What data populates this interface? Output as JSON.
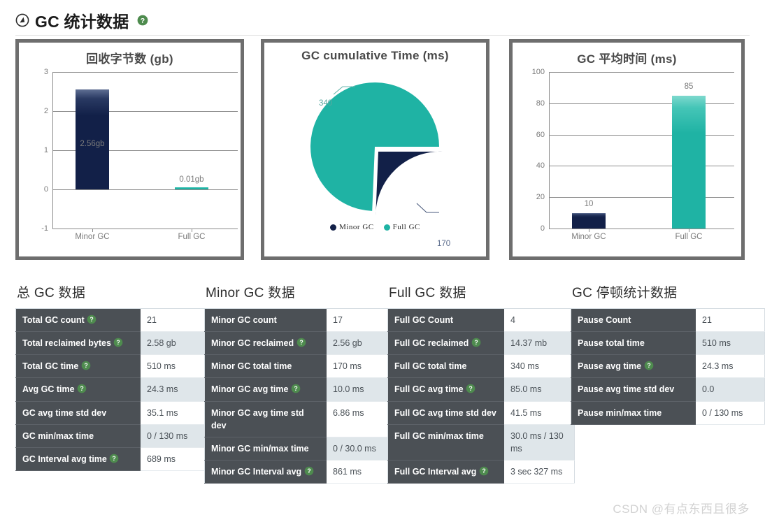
{
  "header": {
    "title": "GC 统计数据",
    "logo_icon": "circle-arrow-icon",
    "help_icon": "help-circle-icon"
  },
  "colors": {
    "navy": "#122048",
    "teal": "#1fb3a4",
    "table_label_bg": "#4b5055",
    "table_alt_bg": "#dfe6ea",
    "card_border": "#6e6e6e",
    "help_green": "#4e8b4e"
  },
  "chart_data": [
    {
      "type": "bar",
      "title": "回收字节数 (gb)",
      "categories": [
        "Minor GC",
        "Full GC"
      ],
      "values": [
        2.56,
        0.01
      ],
      "data_labels": [
        "2.56gb",
        "0.01gb"
      ],
      "series_colors": [
        "#122048",
        "#1fb3a4"
      ],
      "xlabel": "",
      "ylabel": "",
      "ylim": [
        -1,
        3
      ],
      "yticks": [
        "3",
        "2",
        "1",
        "0",
        "-1"
      ],
      "grid": true,
      "legend": "none"
    },
    {
      "type": "pie",
      "title": "GC cumulative Time (ms)",
      "categories": [
        "Minor GC",
        "Full GC"
      ],
      "values": [
        170,
        340
      ],
      "data_labels": [
        "170",
        "340"
      ],
      "series_colors": [
        "#122048",
        "#1fb3a4"
      ],
      "legend": "bottom",
      "legend_entries": [
        "Minor GC",
        "Full GC"
      ]
    },
    {
      "type": "bar",
      "title": "GC 平均时间 (ms)",
      "categories": [
        "Minor GC",
        "Full GC"
      ],
      "values": [
        10,
        85
      ],
      "data_labels": [
        "10",
        "85"
      ],
      "series_colors": [
        "#122048",
        "#1fb3a4"
      ],
      "xlabel": "",
      "ylabel": "",
      "ylim": [
        0,
        100
      ],
      "yticks": [
        "100",
        "80",
        "60",
        "40",
        "20",
        "0"
      ],
      "grid": true,
      "legend": "none"
    }
  ],
  "tables": [
    {
      "heading": "总 GC 数据",
      "rows": [
        {
          "label": "Total GC count",
          "help": true,
          "value": "21"
        },
        {
          "label": "Total reclaimed bytes",
          "help": true,
          "value": "2.58 gb"
        },
        {
          "label": "Total GC time",
          "help": true,
          "value": "510 ms"
        },
        {
          "label": "Avg GC time",
          "help": true,
          "value": "24.3 ms"
        },
        {
          "label": "GC avg time std dev",
          "help": false,
          "value": "35.1 ms"
        },
        {
          "label": "GC min/max time",
          "help": false,
          "value": "0 / 130 ms"
        },
        {
          "label": "GC Interval avg time",
          "help": true,
          "value": "689 ms"
        }
      ]
    },
    {
      "heading": "Minor GC 数据",
      "rows": [
        {
          "label": "Minor GC count",
          "help": false,
          "value": "17"
        },
        {
          "label": "Minor GC reclaimed",
          "help": true,
          "value": "2.56 gb"
        },
        {
          "label": "Minor GC total time",
          "help": false,
          "value": "170 ms"
        },
        {
          "label": "Minor GC avg time",
          "help": true,
          "value": "10.0 ms"
        },
        {
          "label": "Minor GC avg time std dev",
          "help": false,
          "value": "6.86 ms"
        },
        {
          "label": "Minor GC min/max time",
          "help": false,
          "value": "0 / 30.0 ms"
        },
        {
          "label": "Minor GC Interval avg",
          "help": true,
          "value": "861 ms"
        }
      ]
    },
    {
      "heading": "Full GC 数据",
      "rows": [
        {
          "label": "Full GC Count",
          "help": false,
          "value": "4"
        },
        {
          "label": "Full GC reclaimed",
          "help": true,
          "value": "14.37 mb"
        },
        {
          "label": "Full GC total time",
          "help": false,
          "value": "340 ms"
        },
        {
          "label": "Full GC avg time",
          "help": true,
          "value": "85.0 ms"
        },
        {
          "label": "Full GC avg time std dev",
          "help": false,
          "value": "41.5 ms"
        },
        {
          "label": "Full GC min/max time",
          "help": false,
          "value": "30.0 ms / 130 ms"
        },
        {
          "label": "Full GC Interval avg",
          "help": true,
          "value": "3 sec 327 ms"
        }
      ]
    },
    {
      "heading": "GC 停顿统计数据",
      "rows": [
        {
          "label": "Pause Count",
          "help": false,
          "value": "21"
        },
        {
          "label": "Pause total time",
          "help": false,
          "value": "510 ms"
        },
        {
          "label": "Pause avg time",
          "help": true,
          "value": "24.3 ms"
        },
        {
          "label": "Pause avg time std dev",
          "help": false,
          "value": "0.0"
        },
        {
          "label": "Pause min/max time",
          "help": false,
          "value": "0 / 130 ms"
        }
      ]
    }
  ],
  "watermark": "CSDN @有点东西且很多"
}
